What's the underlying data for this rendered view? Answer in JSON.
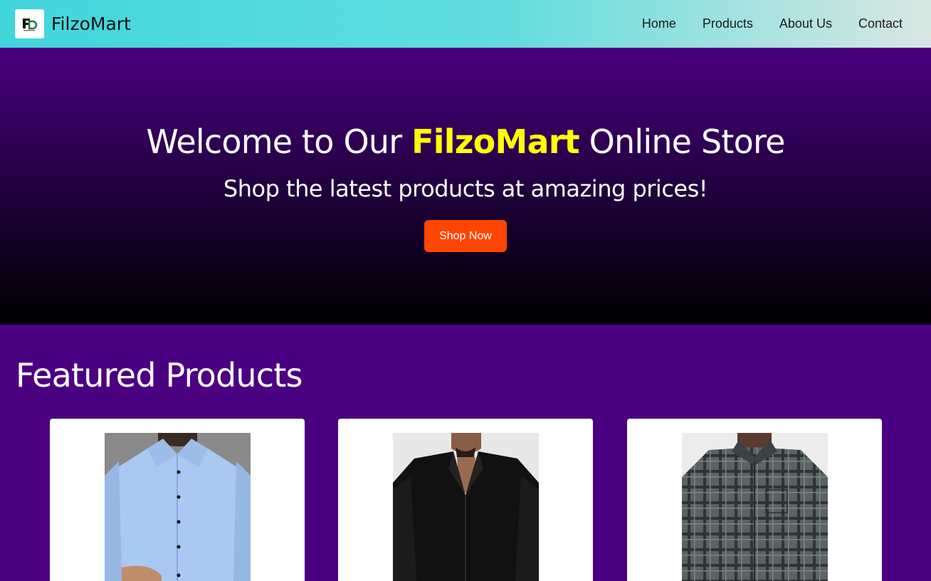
{
  "navbar": {
    "brand_name": "FilzoMart",
    "logo_text": "FD",
    "links": [
      "Home",
      "Products",
      "About Us",
      "Contact"
    ]
  },
  "hero": {
    "title_prefix": "Welcome to Our ",
    "title_brand": "FilzoMart",
    "title_suffix": " Online Store",
    "subtitle": "Shop the latest products at amazing prices!",
    "cta_label": "Shop Now"
  },
  "featured": {
    "title": "Featured Products",
    "products": [
      {
        "image": "light-blue-shirt"
      },
      {
        "image": "black-shirt"
      },
      {
        "image": "grey-checked-shirt"
      }
    ]
  },
  "colors": {
    "primary": "#4b0082",
    "accent": "#ffff00",
    "cta": "#ff4500",
    "nav_gradient_start": "#40d6dc"
  }
}
